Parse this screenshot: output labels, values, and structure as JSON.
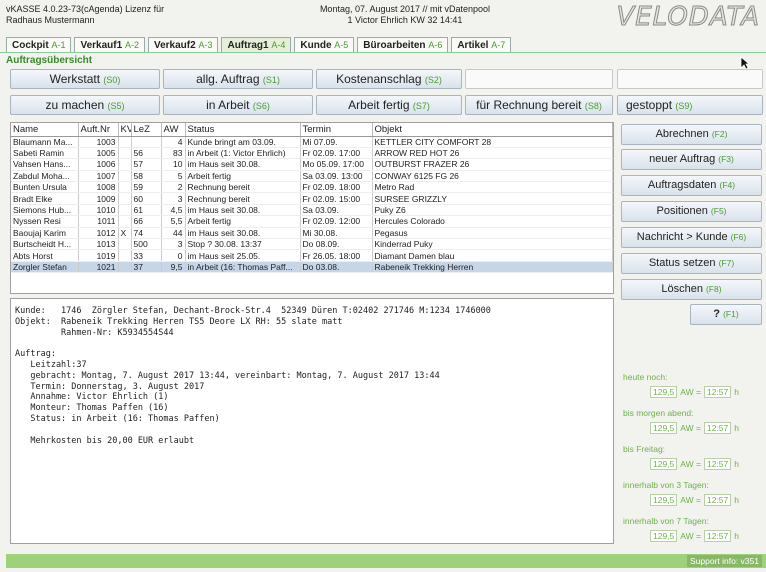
{
  "header": {
    "app_line1": "vKASSE 4.0.23-73(cAgenda) Lizenz für",
    "app_line2": "Radhaus Mustermann",
    "date_line": "Montag, 07. August 2017 // mit vDatenpool",
    "user_line": "1 Victor Ehrlich  KW 32  14:41",
    "logo": "VELODATA"
  },
  "tabs": [
    {
      "label": "Cockpit",
      "key": "A-1"
    },
    {
      "label": "Verkauf1",
      "key": "A-2"
    },
    {
      "label": "Verkauf2",
      "key": "A-3"
    },
    {
      "label": "Auftrag1",
      "key": "A-4"
    },
    {
      "label": "Kunde",
      "key": "A-5"
    },
    {
      "label": "Büroarbeiten",
      "key": "A-6"
    },
    {
      "label": "Artikel",
      "key": "A-7"
    }
  ],
  "section_title": "Auftragsübersicht",
  "status_buttons": {
    "werkstatt": {
      "label": "Werkstatt",
      "code": "(S0)"
    },
    "allg_auftrag": {
      "label": "allg. Auftrag",
      "code": "(S1)"
    },
    "kostenanschlag": {
      "label": "Kostenanschlag",
      "code": "(S2)"
    },
    "zu_machen": {
      "label": "zu machen",
      "code": "(S5)"
    },
    "in_arbeit": {
      "label": "in Arbeit",
      "code": "(S6)"
    },
    "arbeit_fertig": {
      "label": "Arbeit fertig",
      "code": "(S7)"
    },
    "fuer_rechnung": {
      "label": "für Rechnung bereit",
      "code": "(S8)"
    },
    "gestoppt": {
      "label": "gestoppt",
      "code": "(S9)"
    }
  },
  "table": {
    "columns": [
      "Name",
      "Auft.Nr",
      "KV",
      "LeZ",
      "AW",
      "Status",
      "Termin",
      "Objekt"
    ],
    "rows": [
      [
        "Blaumann Ma...",
        "1003",
        "",
        "",
        "4",
        "Kunde bringt  am 03.09.",
        "Mi 07.09.",
        "KETTLER CITY COMFORT 28"
      ],
      [
        "Sabeti Ramin",
        "1005",
        "",
        "56",
        "83",
        "in Arbeit (1: Victor Ehrlich)",
        "Fr 02.09. 17:00",
        "ARROW RED HOT 26"
      ],
      [
        "Vahsen Hans...",
        "1006",
        "",
        "57",
        "10",
        "im Haus  seit 30.08.",
        "Mo 05.09. 17:00",
        "OUTBURST FRAZER 26"
      ],
      [
        "Zabdul Moha...",
        "1007",
        "",
        "58",
        "5",
        "Arbeit fertig",
        "Sa 03.09. 13:00",
        "CONWAY 6125 FG 26"
      ],
      [
        "Bunten Ursula",
        "1008",
        "",
        "59",
        "2",
        "Rechnung bereit",
        "Fr 02.09. 18:00",
        "Metro Rad"
      ],
      [
        "Bradt Elke",
        "1009",
        "",
        "60",
        "3",
        "Rechnung bereit",
        "Fr 02.09. 15:00",
        "SURSEE GRIZZLY"
      ],
      [
        "Siemons Hub...",
        "1010",
        "",
        "61",
        "4,5",
        "im Haus  seit 30.08.",
        "Sa 03.09.",
        "Puky Z6"
      ],
      [
        "Nyssen Resi",
        "1011",
        "",
        "66",
        "5,5",
        "Arbeit fertig",
        "Fr 02.09. 12:00",
        "Hercules Colorado"
      ],
      [
        "Baoujaj Karim",
        "1012",
        "X",
        "74",
        "44",
        "im Haus  seit 30.08.",
        "Mi 30.08.",
        "Pegasus"
      ],
      [
        "Burtscheidt H...",
        "1013",
        "",
        "500",
        "3",
        "Stop ? 30.08. 13:37",
        "Do 08.09.",
        "Kinderrad Puky"
      ],
      [
        "Abts Horst",
        "1019",
        "",
        "33",
        "0",
        "im Haus  seit 25.05.",
        "Fr 26.05. 18:00",
        "Diamant Damen blau"
      ],
      [
        "Zorgler Stefan",
        "1021",
        "",
        "37",
        "9,5",
        "in Arbeit (16: Thomas Paff...",
        "Do 03.08.",
        "Rabeneik Trekking Herren"
      ]
    ],
    "selected_index": 11
  },
  "detail_text": "Kunde:   1746  Zörgler Stefan, Dechant-Brock-Str.4  52349 Düren T:02402 271746 M:1234 1746000\nObjekt:  Rabeneik Trekking Herren TS5 Deore LX RH: 55 slate matt\n         Rahmen-Nr: K5934554S44\n\nAuftrag:\n   Leitzahl:37\n   gebracht: Montag, 7. August 2017 13:44, vereinbart: Montag, 7. August 2017 13:44\n   Termin: Donnerstag, 3. August 2017\n   Annahme: Victor Ehrlich (1)\n   Monteur: Thomas Paffen (16)\n   Status: in Arbeit (16: Thomas Paffen)\n\n   Mehrkosten bis 20,00 EUR erlaubt",
  "actions": [
    {
      "label": "Abrechnen",
      "code": "(F2)"
    },
    {
      "label": "neuer Auftrag",
      "code": "(F3)"
    },
    {
      "label": "Auftragsdaten",
      "code": "(F4)"
    },
    {
      "label": "Positionen",
      "code": "(F5)"
    },
    {
      "label": "Nachricht > Kunde",
      "code": "(F6)"
    },
    {
      "label": "Status setzen",
      "code": "(F7)"
    },
    {
      "label": "Löschen",
      "code": "(F8)"
    }
  ],
  "help_button": {
    "label": "?",
    "code": "(F1)"
  },
  "summary": [
    {
      "label": "heute noch:",
      "value": "129,5",
      "aw_label": "AW =",
      "aw_value": "12:57",
      "unit": "h"
    },
    {
      "label": "bis morgen abend:",
      "value": "129,5",
      "aw_label": "AW =",
      "aw_value": "12:57",
      "unit": "h"
    },
    {
      "label": "bis Freitag:",
      "value": "129,5",
      "aw_label": "AW =",
      "aw_value": "12:57",
      "unit": "h"
    },
    {
      "label": "innerhalb von 3 Tagen:",
      "value": "129,5",
      "aw_label": "AW =",
      "aw_value": "12:57",
      "unit": "h"
    },
    {
      "label": "innerhalb von 7 Tagen:",
      "value": "129,5",
      "aw_label": "AW =",
      "aw_value": "12:57",
      "unit": "h"
    }
  ],
  "statusbar": {
    "support": "Support info: v351"
  },
  "colors": {
    "accent_green": "#4a9a30",
    "selection": "#c6d6e8",
    "statusbar": "#9fd07a"
  },
  "icons": {
    "cursor": "mouse-pointer-icon"
  }
}
